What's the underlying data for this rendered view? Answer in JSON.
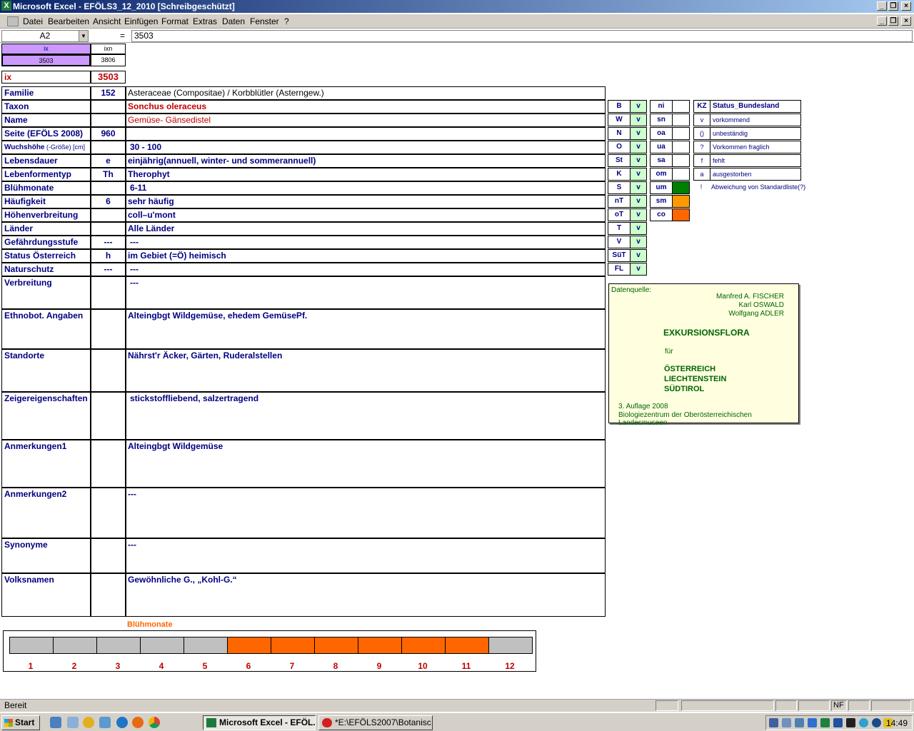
{
  "window": {
    "title": "Microsoft Excel - EFÖLS3_12_2010  [Schreibgeschützt]",
    "icon": "excel-icon"
  },
  "menu": [
    "Datei",
    "Bearbeiten",
    "Ansicht",
    "Einfügen",
    "Format",
    "Extras",
    "Daten",
    "Fenster",
    "?"
  ],
  "formula": {
    "cell_ref": "A2",
    "equals": "=",
    "value": "3503"
  },
  "index": {
    "ix_header": "ix",
    "ixn_header": "ixn",
    "ix_value": "3503",
    "ixn_value": "3806",
    "ix_label": "ix",
    "ix_big": "3503"
  },
  "rows": [
    {
      "label": "Familie",
      "code": "152",
      "value": "Asteraceae (Compositae)  /  Korbblütler (Asterngew.)"
    },
    {
      "label": "Taxon",
      "code": "",
      "value": "Sonchus oleraceus"
    },
    {
      "label": "Name",
      "code": "",
      "value": "Gemüse- Gänsedistel"
    },
    {
      "label": "Seite (EFÖLS 2008)",
      "code": "960",
      "value": ""
    },
    {
      "label": "Wuchshöhe",
      "label_suffix": " (-Größe) [cm]",
      "code": "",
      "value": "30 - 100"
    },
    {
      "label": "Lebensdauer",
      "code": "e",
      "value": "einjährig(annuell, winter- und sommerannuell)"
    },
    {
      "label": "Lebenformentyp",
      "code": "Th",
      "value": "Therophyt"
    },
    {
      "label": "Blühmonate",
      "code": "",
      "value": "6-11"
    },
    {
      "label": "Häufigkeit",
      "code": "6",
      "value": "sehr häufig"
    },
    {
      "label": "Höhenverbreitung",
      "code": "",
      "value": "coll–u'mont"
    },
    {
      "label": "Länder",
      "code": "",
      "value": "Alle Länder"
    },
    {
      "label": "Gefährdungsstufe",
      "code": "---",
      "value": "---"
    },
    {
      "label": "Status Österreich",
      "code": "h",
      "value": "im Gebiet (=Ö) heimisch"
    },
    {
      "label": "Naturschutz",
      "code": "---",
      "value": "---"
    }
  ],
  "tall_rows": [
    {
      "label": "Verbreitung",
      "value": "---"
    },
    {
      "label": "Ethnobot. Angaben",
      "value": "Alteingbgt Wildgemüse, ehedem GemüsePf."
    },
    {
      "label": "Standorte",
      "value": "Nährst'r Äcker, Gärten, Ruderalstellen"
    },
    {
      "label": "Zeigereigenschaften",
      "value": " stickstoffliebend, salzertragend"
    },
    {
      "label": "Anmerkungen1",
      "value": "Alteingbgt Wildgemüse"
    },
    {
      "label": "Anmerkungen2",
      "value": "---"
    },
    {
      "label": "Synonyme",
      "value": "---"
    },
    {
      "label": "Volksnamen",
      "value": "Gewöhnliche G., „Kohl-G.“"
    }
  ],
  "regions": [
    {
      "k": "B",
      "v": "v"
    },
    {
      "k": "W",
      "v": "v"
    },
    {
      "k": "N",
      "v": "v"
    },
    {
      "k": "O",
      "v": "v"
    },
    {
      "k": "St",
      "v": "v"
    },
    {
      "k": "K",
      "v": "v"
    },
    {
      "k": "S",
      "v": "v"
    },
    {
      "k": "nT",
      "v": "v"
    },
    {
      "k": "oT",
      "v": "v"
    },
    {
      "k": "T",
      "v": "v"
    },
    {
      "k": "V",
      "v": "v"
    },
    {
      "k": "SüT",
      "v": "v"
    },
    {
      "k": "FL",
      "v": "v"
    }
  ],
  "altitude": [
    {
      "k": "ni",
      "color": ""
    },
    {
      "k": "sn",
      "color": ""
    },
    {
      "k": "oa",
      "color": ""
    },
    {
      "k": "ua",
      "color": ""
    },
    {
      "k": "sa",
      "color": ""
    },
    {
      "k": "om",
      "color": ""
    },
    {
      "k": "um",
      "color": "#008000"
    },
    {
      "k": "sm",
      "color": "#ff9900"
    },
    {
      "k": "co",
      "color": "#ff6600"
    }
  ],
  "status_key": {
    "header_k": "KZ",
    "header_d": "Status_Bundesland",
    "items": [
      {
        "k": "v",
        "d": "vorkommend"
      },
      {
        "k": "()",
        "d": "unbeständig"
      },
      {
        "k": "?",
        "d": "Vorkommen fraglich"
      },
      {
        "k": "f",
        "d": "fehlt"
      },
      {
        "k": "a",
        "d": "ausgestorben"
      }
    ],
    "note_k": "!",
    "note_d": "Abweichung von Standardliste(?)"
  },
  "quelle": {
    "label": "Datenquelle:",
    "authors": [
      "Manfred A. FISCHER",
      "Karl OSWALD",
      "Wolfgang ADLER"
    ],
    "title": "EXKURSIONSFLORA",
    "fuer": "für",
    "countries": [
      "ÖSTERREICH",
      "LIECHTENSTEIN",
      "SÜDTIROL"
    ],
    "edition": "3. Auflage 2008",
    "publisher": "Biologiezentrum der Oberösterreichischen Landesmuseen"
  },
  "bluehmonate_chart": {
    "title": "Blühmonate",
    "months": [
      "1",
      "2",
      "3",
      "4",
      "5",
      "6",
      "7",
      "8",
      "9",
      "10",
      "11",
      "12"
    ],
    "flowering": [
      0,
      0,
      0,
      0,
      0,
      1,
      1,
      1,
      1,
      1,
      1,
      0
    ],
    "on_color": "#ff6600",
    "off_color": "#c0c0c0"
  },
  "status": {
    "text": "Bereit",
    "nf": "NF"
  },
  "taskbar": {
    "start": "Start",
    "tasks": [
      "Microsoft Excel - EFÖL...",
      "*E:\\EFÖLS2007\\Botanisc..."
    ],
    "clock": "14:49"
  }
}
